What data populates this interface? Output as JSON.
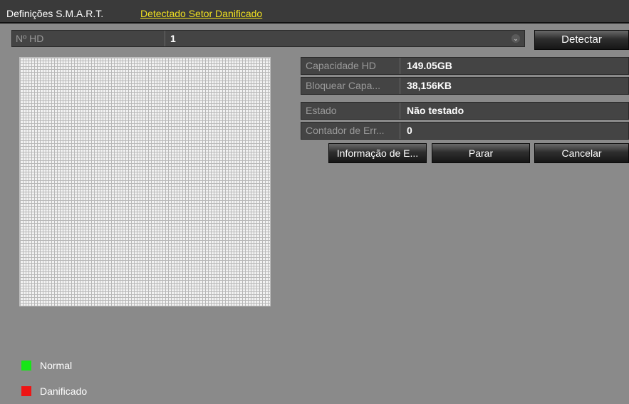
{
  "tabs": [
    {
      "label": "Definições S.M.A.R.T."
    },
    {
      "label": "Detectado Setor Danificado"
    }
  ],
  "hd": {
    "label": "Nº HD",
    "value": "1",
    "detect_label": "Detectar"
  },
  "info": [
    {
      "label": "Capacidade HD",
      "value": "149.05GB"
    },
    {
      "label": "Bloquear Capa...",
      "value": "38,156KB"
    },
    {
      "label": "Estado",
      "value": "Não testado"
    },
    {
      "label": "Contador de Err...",
      "value": "0"
    }
  ],
  "buttons": {
    "info": "Informação de E...",
    "stop": "Parar",
    "cancel": "Cancelar"
  },
  "legend": [
    {
      "label": "Normal",
      "color": "#17e617"
    },
    {
      "label": "Danificado",
      "color": "#ee1515"
    }
  ],
  "colors": {
    "active_tab": "#f0e020"
  }
}
